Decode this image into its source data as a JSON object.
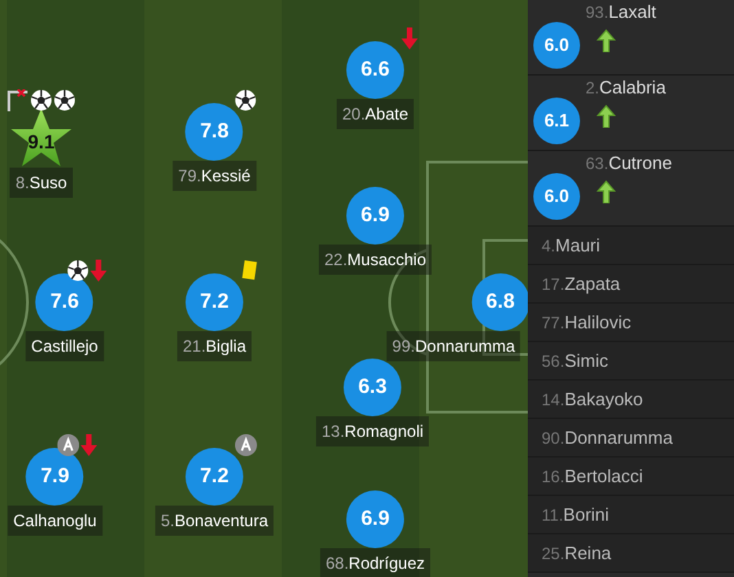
{
  "pitch_players": [
    {
      "number": "8.",
      "name": "Suso",
      "rating": "9.1",
      "top_rated": true,
      "events": [
        {
          "kind": "post"
        },
        {
          "kind": "goal"
        },
        {
          "kind": "goal"
        }
      ]
    },
    {
      "number": "79.",
      "name": "Kessié",
      "rating": "7.8",
      "top_rated": false,
      "events": [
        {
          "kind": "goal"
        }
      ]
    },
    {
      "number": "20.",
      "name": "Abate",
      "rating": "6.6",
      "top_rated": false,
      "events": [
        {
          "kind": "sub_out"
        }
      ]
    },
    {
      "number": "22.",
      "name": "Musacchio",
      "rating": "6.9",
      "top_rated": false
    },
    {
      "name": "Castillejo",
      "rating": "7.6",
      "top_rated": false,
      "events": [
        {
          "kind": "goal"
        },
        {
          "kind": "sub_out"
        }
      ]
    },
    {
      "number": "21.",
      "name": "Biglia",
      "rating": "7.2",
      "top_rated": false,
      "events": [
        {
          "kind": "yellow_card"
        }
      ]
    },
    {
      "number": "99.",
      "name": "Donnarumma",
      "rating": "6.8",
      "top_rated": false
    },
    {
      "number": "13.",
      "name": "Romagnoli",
      "rating": "6.3",
      "top_rated": false
    },
    {
      "name": "Calhanoglu",
      "rating": "7.9",
      "top_rated": false,
      "events": [
        {
          "kind": "assist"
        },
        {
          "kind": "sub_out"
        }
      ]
    },
    {
      "number": "5.",
      "name": "Bonaventura",
      "rating": "7.2",
      "top_rated": false,
      "events": [
        {
          "kind": "assist"
        }
      ]
    },
    {
      "number": "68.",
      "name": "Rodríguez",
      "rating": "6.9",
      "top_rated": false
    }
  ],
  "substitutes": [
    {
      "number": "93.",
      "name": "Laxalt",
      "rating": "6.0",
      "events": [
        {
          "kind": "sub_in"
        }
      ]
    },
    {
      "number": "2.",
      "name": "Calabria",
      "rating": "6.1",
      "events": [
        {
          "kind": "sub_in"
        }
      ]
    },
    {
      "number": "63.",
      "name": "Cutrone",
      "rating": "6.0",
      "events": [
        {
          "kind": "sub_in"
        }
      ]
    }
  ],
  "bench": [
    {
      "number": "4.",
      "name": "Mauri"
    },
    {
      "number": "17.",
      "name": "Zapata"
    },
    {
      "number": "77.",
      "name": "Halilovic"
    },
    {
      "number": "56.",
      "name": "Simic"
    },
    {
      "number": "14.",
      "name": "Bakayoko"
    },
    {
      "number": "90.",
      "name": "Donnarumma"
    },
    {
      "number": "16.",
      "name": "Bertolacci"
    },
    {
      "number": "11.",
      "name": "Borini"
    },
    {
      "number": "25.",
      "name": "Reina"
    }
  ]
}
